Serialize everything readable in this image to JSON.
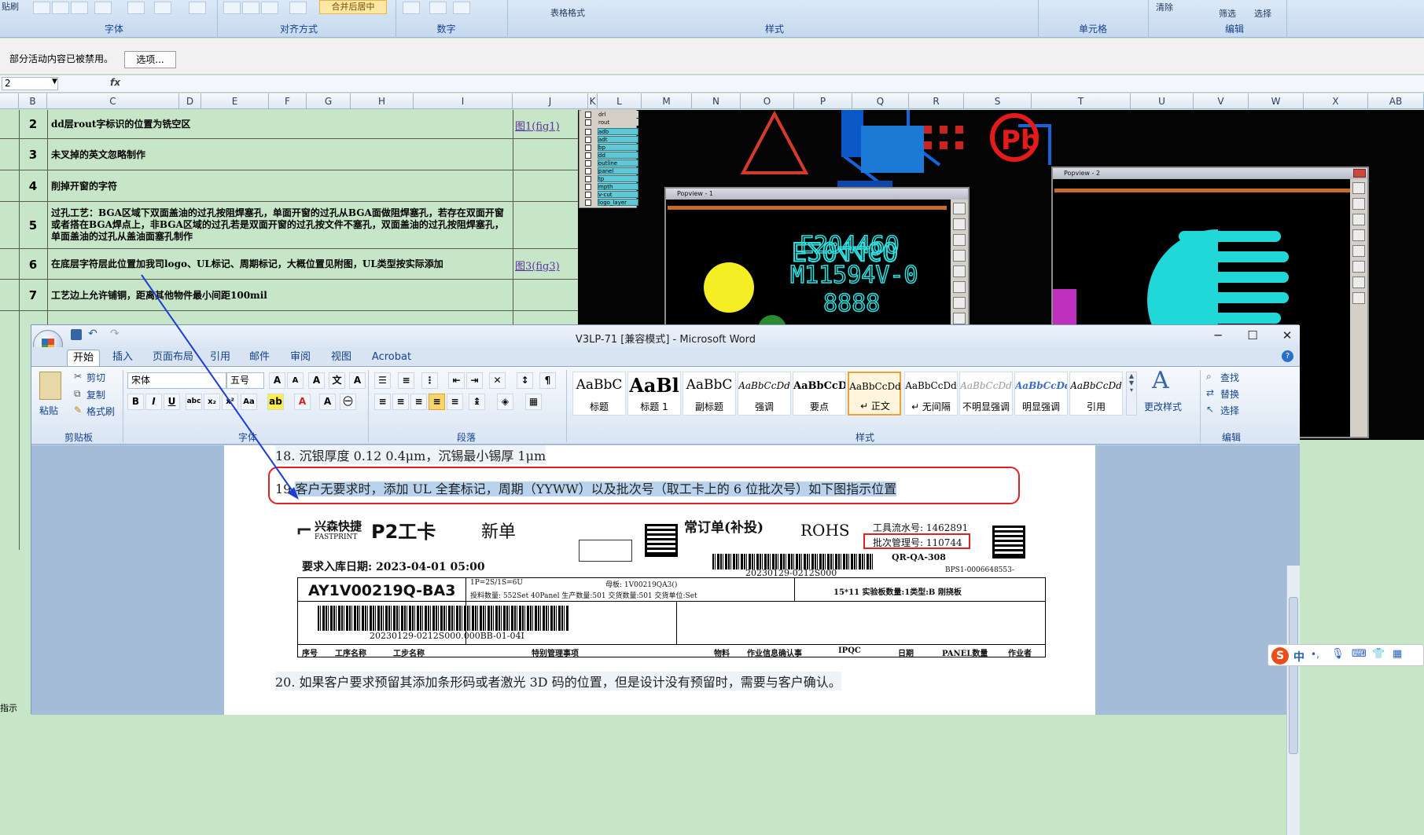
{
  "excel": {
    "ribbon_groups": [
      "字体",
      "对齐方式",
      "数字",
      "样式",
      "单元格",
      "编辑"
    ],
    "top_fragments": {
      "paste": "贴刷",
      "merge": "合并后居中",
      "format_as_table": "表格格式",
      "clear": "清除",
      "filter": "筛选",
      "select": "选择"
    },
    "security_message": "部分活动内容已被禁用。",
    "options_button": "选项...",
    "name_box": "2",
    "fx": "fx",
    "columns": [
      "B",
      "C",
      "D",
      "E",
      "F",
      "G",
      "H",
      "I",
      "J",
      "K",
      "L",
      "M",
      "N",
      "O",
      "P",
      "Q",
      "R",
      "S",
      "T",
      "U",
      "V",
      "W",
      "X",
      "AB"
    ],
    "rows": [
      {
        "num": "2",
        "text": "dd层rout字标识的位置为铣空区",
        "link": "图1(fig1)"
      },
      {
        "num": "3",
        "text": "未叉掉的英文忽略制作",
        "link": ""
      },
      {
        "num": "4",
        "text": "削掉开窗的字符",
        "link": ""
      },
      {
        "num": "5",
        "text": "过孔工艺：BGA区域下双面盖油的过孔按阻焊塞孔，单面开窗的过孔从BGA面做阻焊塞孔，若存在双面开窗或者搭在BGA焊点上，非BGA区域的过孔若是双面开窗的过孔按文件不塞孔，双面盖油的过孔按阻焊塞孔，单面盖油的过孔从盖油面塞孔制作",
        "link": ""
      },
      {
        "num": "6",
        "text": "在底层字符层此位置加我司logo、UL标记、周期标记，大概位置见附图，UL类型按实际添加",
        "link": "图3(fig3)"
      },
      {
        "num": "7",
        "text": "工艺边上允许铺铜，距离其他物件最小间距100mil",
        "link": ""
      }
    ],
    "status": "指示"
  },
  "layers": [
    "drl",
    "rout",
    "adb",
    "adt",
    "bp",
    "dd",
    "outline",
    "panel",
    "tp",
    "mpth",
    "v-cut",
    "logo_layer"
  ],
  "popview1": {
    "title": "Popview - 1",
    "line1": "E20446O",
    "line2": "M11594V-0",
    "line3": "8888"
  },
  "popview2": {
    "title": "Popview - 2"
  },
  "word": {
    "title": "V3LP-71 [兼容模式] - Microsoft Word",
    "tabs": [
      "开始",
      "插入",
      "页面布局",
      "引用",
      "邮件",
      "审阅",
      "视图",
      "Acrobat"
    ],
    "clipboard": {
      "paste": "粘贴",
      "cut": "剪切",
      "copy": "复制",
      "format_painter": "格式刷",
      "label": "剪贴板"
    },
    "font": {
      "name": "宋体",
      "size": "五号",
      "label": "字体"
    },
    "paragraph_label": "段落",
    "styles": [
      {
        "sample": "AaBbC",
        "label": "标题"
      },
      {
        "sample": "AaBl",
        "label": "标题 1"
      },
      {
        "sample": "AaBbC",
        "label": "副标题"
      },
      {
        "sample": "AaBbCcDd",
        "label": "强调"
      },
      {
        "sample": "AaBbCcD",
        "label": "要点"
      },
      {
        "sample": "AaBbCcDd",
        "label": "↵ 正文"
      },
      {
        "sample": "AaBbCcDd",
        "label": "↵ 无间隔"
      },
      {
        "sample": "AaBbCcDd",
        "label": "不明显强调"
      },
      {
        "sample": "AaBbCcDd",
        "label": "明显强调"
      },
      {
        "sample": "AaBbCcDd",
        "label": "引用"
      }
    ],
    "styles_label": "样式",
    "change_styles": "更改样式",
    "editing": {
      "find": "查找",
      "replace": "替换",
      "select": "选择",
      "label": "编辑"
    },
    "doc": {
      "line18": "18. 沉银厚度 0.12 0.4μm，沉锡最小锡厚 1μm",
      "line19_num": "19.",
      "line19": "客户无要求时，添加 UL 全套标记，周期（YYWW）以及批次号（取工卡上的 6 位批次号）如下图指示位置",
      "line20": "20. 如果客户要求预留其添加条形码或者激光 3D 码的位置，但是设计没有预留时，需要与客户确认。"
    },
    "card": {
      "company": "兴森快捷",
      "company_en": "FASTPRINT",
      "card_name": "P2工卡",
      "new_order": "新单",
      "order_type": "常订单(补投)",
      "rohs": "ROHS",
      "tool_no": "工具流水号: 1462891",
      "batch_no": "批次管理号: 110744",
      "qr_code_no": "QR-QA-308",
      "due_date": "要求入库日期: 2023-04-01 05:00",
      "barcode_text": "20230129-0212S000",
      "bps": "BPS1-0006648553-",
      "part_no": "AY1V00219Q-BA3",
      "spec": "1P=2S/1S=6U",
      "mother_board": "母板: 1V00219QA3()",
      "qty_line": "投料数量: 552Set  40Panel  生产数量:501  交货数量:501  交货单位:Set",
      "board_info": "15*11   实验板数量:1类型:B 刚挠板",
      "barcode2_text": "20230129-0212S000.000BB-01-04I",
      "headers": [
        "序号",
        "工序名称",
        "工步名称",
        "特别管理事项",
        "物料",
        "作业信息确认事",
        "IPQC",
        "日期",
        "PANEL数量",
        "作业者"
      ]
    }
  },
  "ime": {
    "logo": "S",
    "mode": "中"
  }
}
